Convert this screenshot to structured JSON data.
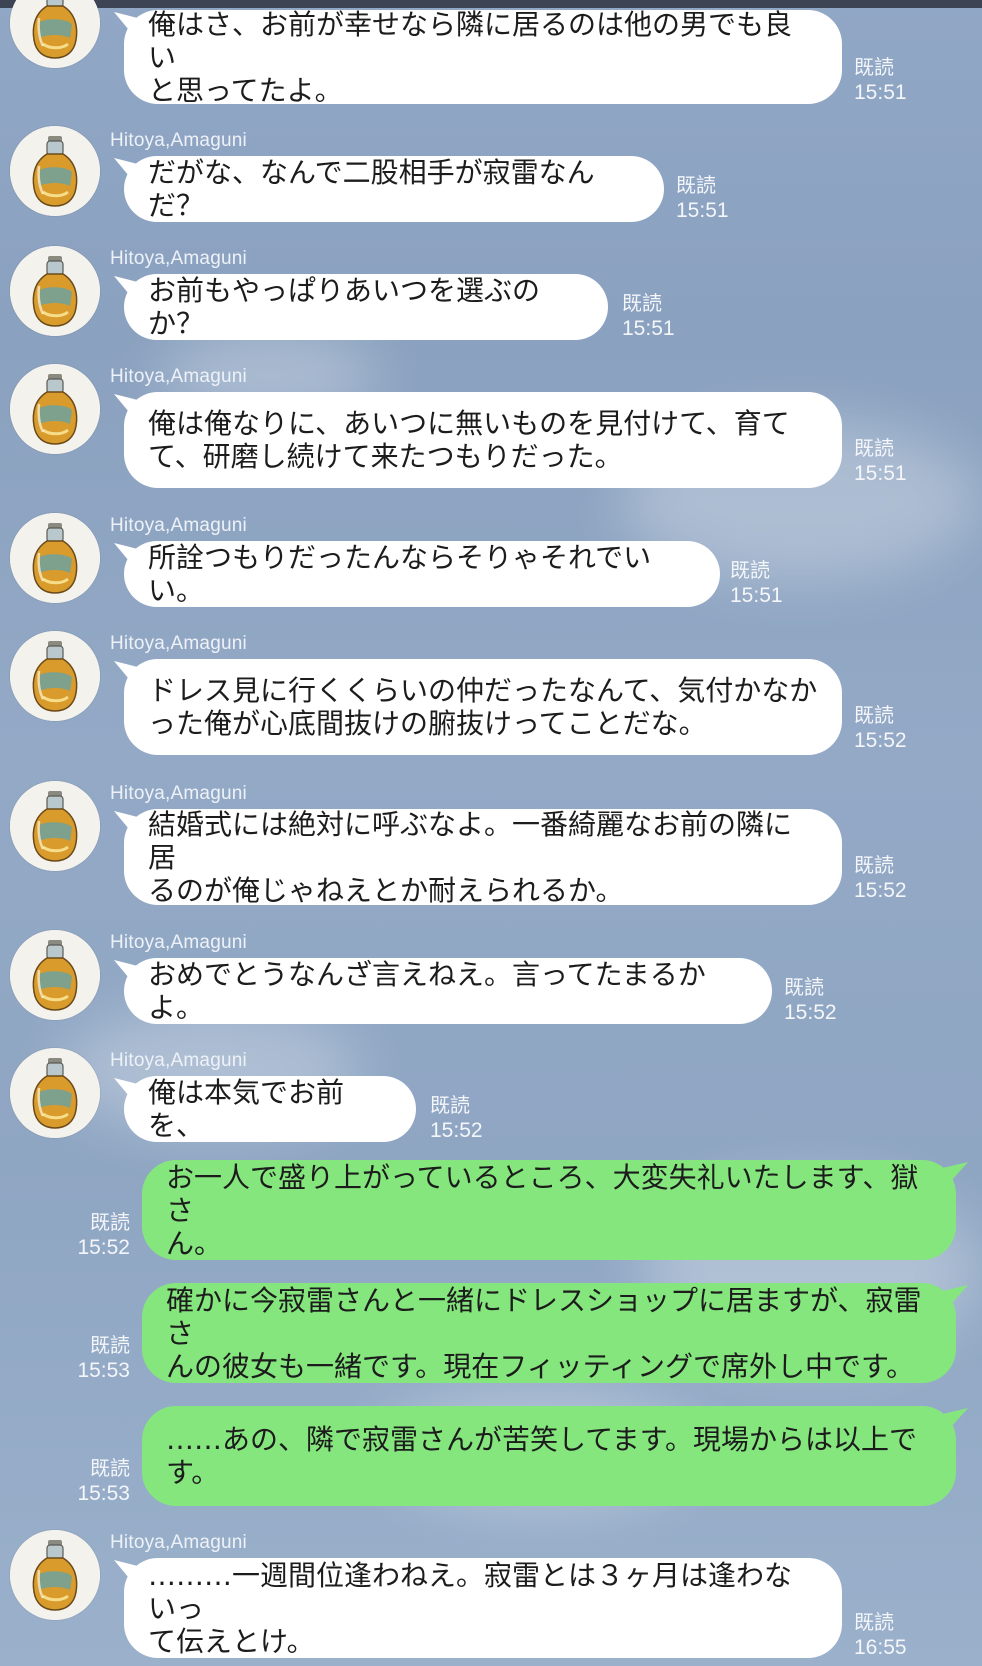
{
  "sender_name": "Hitoya,Amaguni",
  "read_label": "既読",
  "messages": [
    {
      "side": "in",
      "lines": [
        "俺はさ、お前が幸せなら隣に居るのは他の男でも良い",
        "と思ってたよ。"
      ],
      "time": "15:51",
      "show_avatar": false
    },
    {
      "side": "in",
      "lines": [
        "だがな、なんで二股相手が寂雷なんだ？"
      ],
      "time": "15:51",
      "show_avatar": true
    },
    {
      "side": "in",
      "lines": [
        "お前もやっぱりあいつを選ぶのか？"
      ],
      "time": "15:51",
      "show_avatar": true
    },
    {
      "side": "in",
      "lines": [
        "俺は俺なりに、あいつに無いものを見付けて、育て",
        "て、研磨し続けて来たつもりだった。"
      ],
      "time": "15:51",
      "show_avatar": true
    },
    {
      "side": "in",
      "lines": [
        "所詮つもりだったんならそりゃそれでいい。"
      ],
      "time": "15:51",
      "show_avatar": true
    },
    {
      "side": "in",
      "lines": [
        "ドレス見に行くくらいの仲だったなんて、気付かなか",
        "った俺が心底間抜けの腑抜けってことだな。"
      ],
      "time": "15:52",
      "show_avatar": true
    },
    {
      "side": "in",
      "lines": [
        "結婚式には絶対に呼ぶなよ。一番綺麗なお前の隣に居",
        "るのが俺じゃねえとか耐えられるか。"
      ],
      "time": "15:52",
      "show_avatar": true
    },
    {
      "side": "in",
      "lines": [
        "おめでとうなんざ言えねえ。言ってたまるかよ。"
      ],
      "time": "15:52",
      "show_avatar": true
    },
    {
      "side": "in",
      "lines": [
        "俺は本気でお前を、"
      ],
      "time": "15:52",
      "show_avatar": true
    },
    {
      "side": "out",
      "lines": [
        "お一人で盛り上がっているところ、大変失礼いたします、獄さ",
        "ん。"
      ],
      "time": "15:52"
    },
    {
      "side": "out",
      "lines": [
        "確かに今寂雷さんと一緒にドレスショップに居ますが、寂雷さ",
        "んの彼女も一緒です。現在フィッティングで席外し中です。"
      ],
      "time": "15:53"
    },
    {
      "side": "out",
      "lines": [
        "……あの、隣で寂雷さんが苦笑してます。現場からは以上で",
        "す。"
      ],
      "time": "15:53"
    },
    {
      "side": "in",
      "lines": [
        "………一週間位逢わねえ。寂雷とは３ヶ月は逢わないっ",
        "て伝えとけ。"
      ],
      "time": "16:55",
      "show_avatar": true
    }
  ]
}
